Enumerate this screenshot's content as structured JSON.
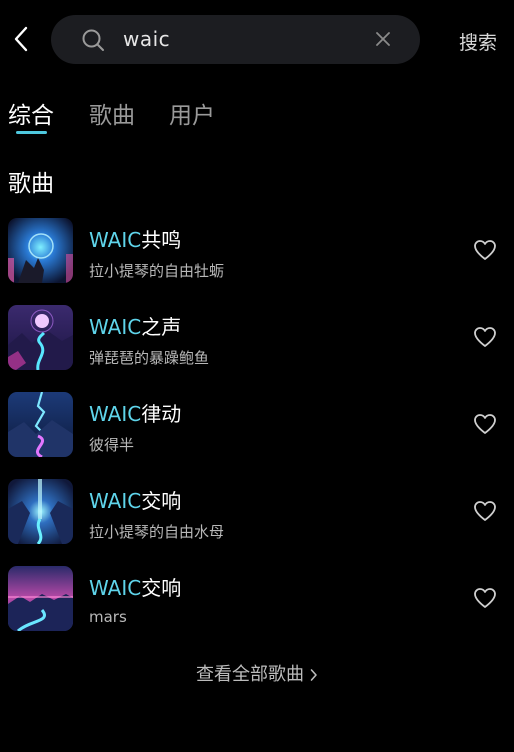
{
  "header": {
    "back_icon": "chevron-left-icon",
    "search": {
      "icon": "search-icon",
      "value": "waic",
      "clear_icon": "close-icon"
    },
    "search_button_label": "搜索"
  },
  "tabs": [
    {
      "label": "综合",
      "active": true
    },
    {
      "label": "歌曲",
      "active": false
    },
    {
      "label": "用户",
      "active": false
    }
  ],
  "colors": {
    "accent": "#5fd4ea",
    "background": "#000000",
    "search_bg": "#1c1d21"
  },
  "songs_section": {
    "title": "歌曲",
    "items": [
      {
        "highlight": "WAIC",
        "rest": "共鸣",
        "artist": "拉小提琴的自由牡蛎",
        "cover": "cover-1",
        "heart_icon": "heart-outline-icon"
      },
      {
        "highlight": "WAIC",
        "rest": "之声",
        "artist": "弹琵琶的暴躁鲍鱼",
        "cover": "cover-2",
        "heart_icon": "heart-outline-icon"
      },
      {
        "highlight": "WAIC",
        "rest": "律动",
        "artist": "彼得半",
        "cover": "cover-3",
        "heart_icon": "heart-outline-icon"
      },
      {
        "highlight": "WAIC",
        "rest": "交响",
        "artist": "拉小提琴的自由水母",
        "cover": "cover-4",
        "heart_icon": "heart-outline-icon"
      },
      {
        "highlight": "WAIC",
        "rest": "交响",
        "artist": "mars",
        "cover": "cover-5",
        "heart_icon": "heart-outline-icon"
      }
    ],
    "view_all_label": "查看全部歌曲"
  }
}
